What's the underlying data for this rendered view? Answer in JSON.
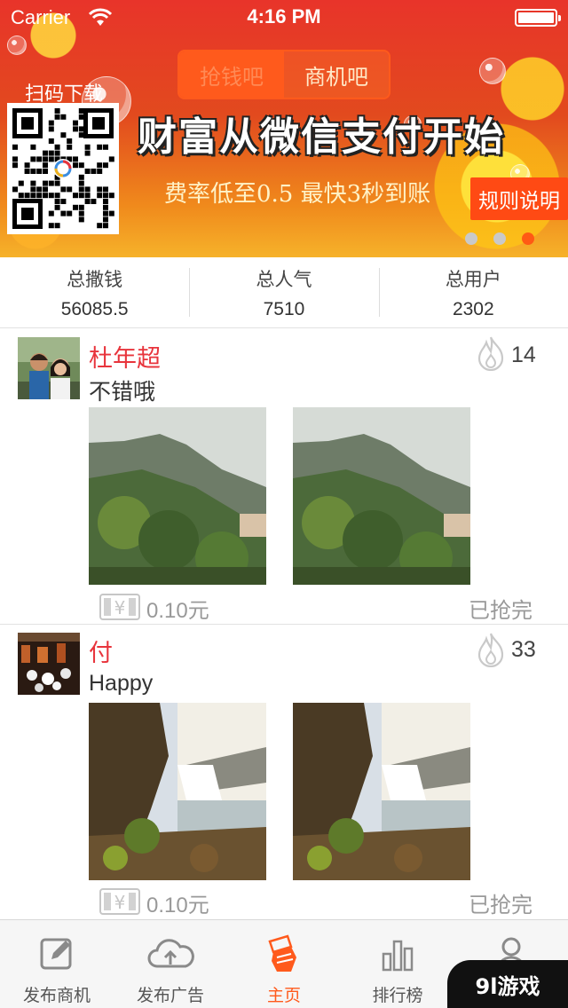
{
  "status_bar": {
    "carrier": "Carrier",
    "time": "4:16 PM"
  },
  "banner": {
    "segments": [
      {
        "label": "抢钱吧",
        "active": true
      },
      {
        "label": "商机吧",
        "active": false
      }
    ],
    "scan_label": "扫码下载",
    "slogan": "财富从微信支付开始",
    "subslogan": "费率低至0.5  最快3秒到账",
    "rules_button": "规则说明",
    "carousel": {
      "count": 3,
      "active_index": 2
    }
  },
  "stats": [
    {
      "label": "总撒钱",
      "value": "56085.5"
    },
    {
      "label": "总人气",
      "value": "7510"
    },
    {
      "label": "总用户",
      "value": "2302"
    }
  ],
  "posts": [
    {
      "username": "杜年超",
      "text": "不错哦",
      "heat": "14",
      "amount": "0.10元",
      "status": "已抢完",
      "image_theme": "mountain-forest"
    },
    {
      "username": "付",
      "text": "Happy",
      "heat": "33",
      "amount": "0.10元",
      "status": "已抢完",
      "image_theme": "waterfall"
    }
  ],
  "tabs": [
    {
      "label": "发布商机",
      "icon": "edit-icon",
      "active": false
    },
    {
      "label": "发布广告",
      "icon": "cloud-upload-icon",
      "active": false
    },
    {
      "label": "主页",
      "icon": "fist-money-icon",
      "active": true
    },
    {
      "label": "排行榜",
      "icon": "bar-chart-icon",
      "active": false
    },
    {
      "label": "",
      "icon": "user-icon",
      "active": false
    }
  ],
  "watermark": "9l游戏",
  "colors": {
    "accent": "#ff5a1c",
    "username": "#e8343c",
    "muted": "#999999"
  }
}
